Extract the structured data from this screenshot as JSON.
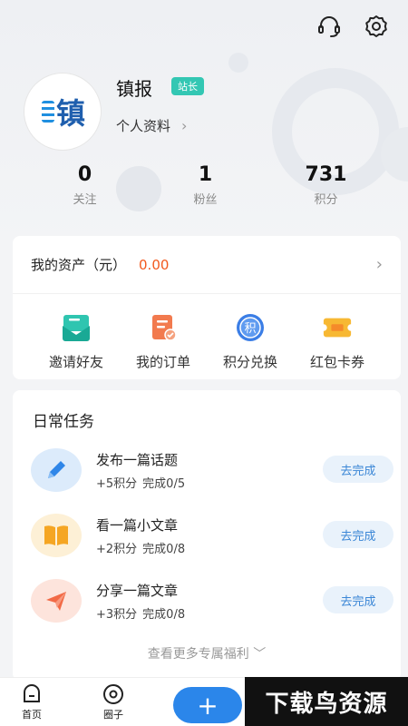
{
  "header": {
    "support_icon": "headset-icon",
    "settings_icon": "gear-icon"
  },
  "profile": {
    "avatar_text": "镇",
    "username": "镇报",
    "badge": "站长",
    "profile_link": "个人资料",
    "stats": [
      {
        "value": "0",
        "label": "关注"
      },
      {
        "value": "1",
        "label": "粉丝"
      },
      {
        "value": "731",
        "label": "积分"
      }
    ]
  },
  "assets": {
    "label": "我的资产（元）",
    "value": "0.00",
    "quick_actions": [
      {
        "label": "邀请好友",
        "icon": "invite-icon"
      },
      {
        "label": "我的订单",
        "icon": "order-icon"
      },
      {
        "label": "积分兑换",
        "icon": "points-icon",
        "icon_text": "积"
      },
      {
        "label": "红包卡券",
        "icon": "coupon-icon"
      }
    ]
  },
  "tasks": {
    "title": "日常任务",
    "items": [
      {
        "title": "发布一篇话题",
        "points": "+5积分",
        "progress": "完成0/5",
        "button": "去完成",
        "icon": "pencil-icon"
      },
      {
        "title": "看一篇小文章",
        "points": "+2积分",
        "progress": "完成0/8",
        "button": "去完成",
        "icon": "book-icon"
      },
      {
        "title": "分享一篇文章",
        "points": "+3积分",
        "progress": "完成0/8",
        "button": "去完成",
        "icon": "paper-plane-icon"
      }
    ],
    "more": "查看更多专属福利"
  },
  "tabbar": {
    "tabs": [
      {
        "label": "首页",
        "icon": "home-icon"
      },
      {
        "label": "圈子",
        "icon": "circle-icon"
      }
    ],
    "fab_label": "+",
    "watermark": "下载鸟资源"
  },
  "colors": {
    "accent": "#2b86ea",
    "badge": "#33c7b3",
    "money": "#f2591e"
  }
}
